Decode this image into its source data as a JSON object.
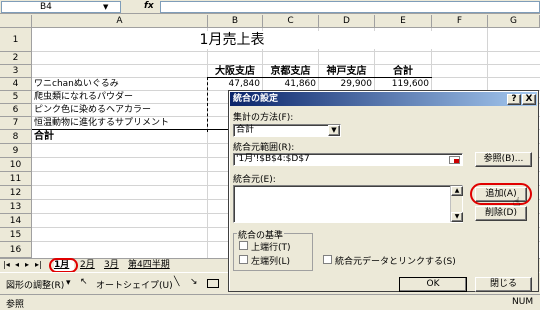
{
  "formula_bar": {
    "name_box": "B4",
    "fx": "fx",
    "value": ""
  },
  "columns": [
    "A",
    "B",
    "C",
    "D",
    "E",
    "F",
    "G"
  ],
  "rows": [
    "1",
    "2",
    "3",
    "4",
    "5",
    "6",
    "7",
    "8",
    "9",
    "10",
    "11",
    "12",
    "13",
    "14",
    "15",
    "16"
  ],
  "sheet": {
    "title": "1月売上表",
    "headers": [
      "大阪支店",
      "京都支店",
      "神戸支店",
      "合計"
    ],
    "items": [
      "ワニchanぬいぐるみ",
      "爬虫類になれるパウダー",
      "ピンク色に染めるヘアカラー",
      "恒温動物に進化するサプリメント"
    ],
    "total_label": "合計",
    "row4_values": [
      "47,840",
      "41,860",
      "29,900",
      "119,600"
    ]
  },
  "tabs": [
    "1月",
    "2月",
    "3月",
    "第4四半期"
  ],
  "drawing_toolbar": {
    "draw_label": "図形の調整(R)",
    "autoshape_label": "オートシェイプ(U)"
  },
  "status": {
    "left": "参照",
    "right": "NUM"
  },
  "dialog": {
    "title": "統合の設定",
    "help": "?",
    "close": "X",
    "function_label": "集計の方法(F):",
    "function_value": "合計",
    "reference_label": "統合元範囲(R):",
    "reference_value": "'1月'!$B$4:$D$7",
    "browse_button": "参照(B)...",
    "all_refs_label": "統合元(E):",
    "add_button": "追加(A)",
    "delete_button": "削除(D)",
    "use_labels_title": "統合の基準",
    "top_row_label": "上端行(T)",
    "left_column_label": "左端列(L)",
    "link_label": "統合元データとリンクする(S)",
    "ok_button": "OK",
    "close_button": "閉じる"
  }
}
